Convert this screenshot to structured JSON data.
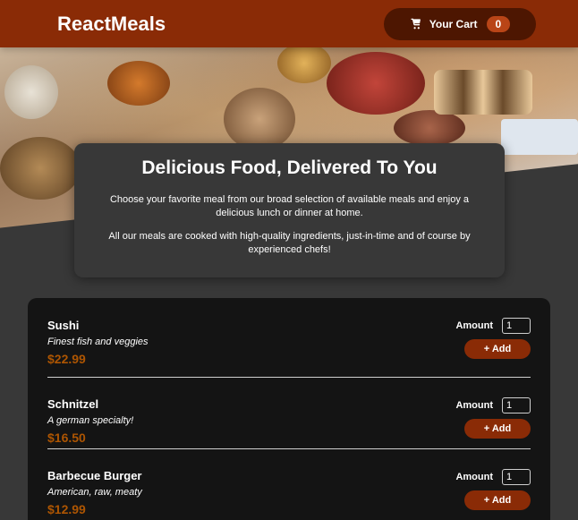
{
  "header": {
    "brand": "ReactMeals",
    "cart_label": "Your Cart",
    "cart_count": "0",
    "cart_icon": "cart-icon"
  },
  "summary": {
    "title": "Delicious Food, Delivered To You",
    "para1": "Choose your favorite meal from our broad selection of available meals and enjoy a delicious lunch or dinner at home.",
    "para2": "All our meals are cooked with high-quality ingredients, just-in-time and of course by experienced chefs!"
  },
  "meals": [
    {
      "name": "Sushi",
      "description": "Finest fish and veggies",
      "price": "$22.99",
      "amount_label": "Amount",
      "amount_value": "1",
      "add_label": "+ Add"
    },
    {
      "name": "Schnitzel",
      "description": "A german specialty!",
      "price": "$16.50",
      "amount_label": "Amount",
      "amount_value": "1",
      "add_label": "+ Add"
    },
    {
      "name": "Barbecue Burger",
      "description": "American, raw, meaty",
      "price": "$12.99",
      "amount_label": "Amount",
      "amount_value": "1",
      "add_label": "+ Add"
    }
  ],
  "colors": {
    "header_bg": "#8a2b06",
    "cart_bg": "#4d1601",
    "badge_bg": "#b94517",
    "price": "#ad5502",
    "page_bg": "#383838",
    "card_bg": "#141414"
  }
}
